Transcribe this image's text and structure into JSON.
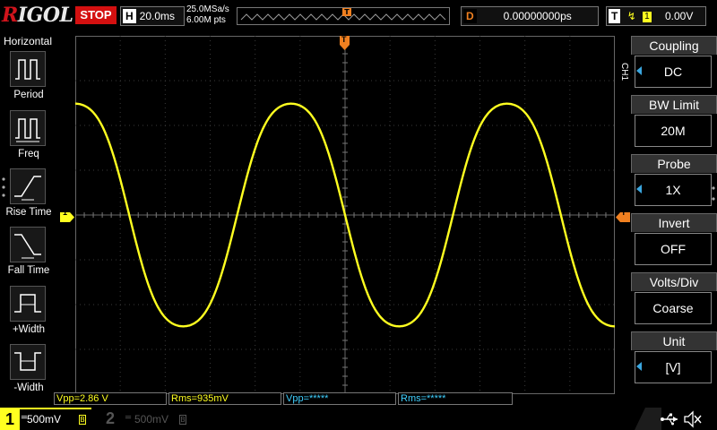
{
  "brand": "RIGOL",
  "status": "STOP",
  "timebase": {
    "letter": "H",
    "value": "20.0ms"
  },
  "sample": {
    "rate": "25.0MSa/s",
    "points": "6.00M pts"
  },
  "delay": {
    "letter": "D",
    "value": "0.00000000ps"
  },
  "trigger": {
    "letter": "T",
    "source": "1",
    "level": "0.00V"
  },
  "left_panel": {
    "title": "Horizontal",
    "items": [
      {
        "label": "Period",
        "icon": "period-icon"
      },
      {
        "label": "Freq",
        "icon": "freq-icon"
      },
      {
        "label": "Rise Time",
        "icon": "rise-time-icon"
      },
      {
        "label": "Fall Time",
        "icon": "fall-time-icon"
      },
      {
        "label": "+Width",
        "icon": "positive-width-icon"
      },
      {
        "label": "-Width",
        "icon": "negative-width-icon"
      }
    ]
  },
  "right_panel": {
    "channel_tab": "CH1",
    "items": [
      {
        "label": "Coupling",
        "value": "DC",
        "arrow": true
      },
      {
        "label": "BW Limit",
        "value": "20M",
        "arrow": false
      },
      {
        "label": "Probe",
        "value": "1X",
        "arrow": true
      },
      {
        "label": "Invert",
        "value": "OFF",
        "arrow": false
      },
      {
        "label": "Volts/Div",
        "value": "Coarse",
        "arrow": false
      },
      {
        "label": "Unit",
        "value": "[V]",
        "arrow": true
      }
    ]
  },
  "measurements": {
    "ch1_vpp": "Vpp=2.86 V",
    "ch1_rms": "Rms=935mV",
    "ch2_vpp": "Vpp=*****",
    "ch2_rms": "Rms=*****"
  },
  "channels": {
    "ch1": {
      "number": "1",
      "scale": "500mV"
    },
    "ch2": {
      "number": "2",
      "scale": "500mV"
    }
  },
  "markers": {
    "ch1_ground": "1",
    "trigger_pos": "T",
    "trigger_level": "T"
  },
  "colors": {
    "ch1": "#ffff20",
    "ch2": "#40d0ff",
    "trigger": "#f08020",
    "stop": "#d41010",
    "menu_arrow": "#3ba7e0"
  },
  "chart_data": {
    "type": "line",
    "grid": {
      "h_divisions": 12,
      "v_divisions": 8,
      "on": true
    },
    "series": [
      {
        "name": "1",
        "period_divisions": 4.8,
        "peak_divisions": 2.75,
        "phase_start_divisions": -1.2
      }
    ]
  }
}
